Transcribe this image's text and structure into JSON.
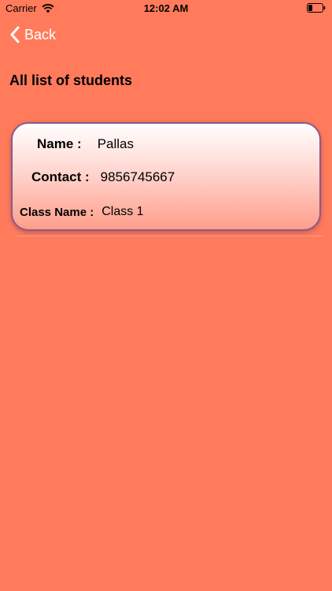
{
  "status_bar": {
    "carrier": "Carrier",
    "time": "12:02 AM",
    "wifi_icon": "wifi-icon",
    "battery_icon": "battery-icon"
  },
  "nav": {
    "back_label": "Back",
    "back_icon": "chevron-left-icon"
  },
  "page": {
    "title": "All list of students"
  },
  "students": [
    {
      "name_label": "Name :",
      "name": "Pallas",
      "contact_label": "Contact :",
      "contact": "9856745667",
      "class_label": "Class Name :",
      "class_name": "Class 1"
    }
  ],
  "colors": {
    "background": "#ff7b5c",
    "card_border": "#8a5a8a",
    "nav_text": "#ffffff"
  }
}
